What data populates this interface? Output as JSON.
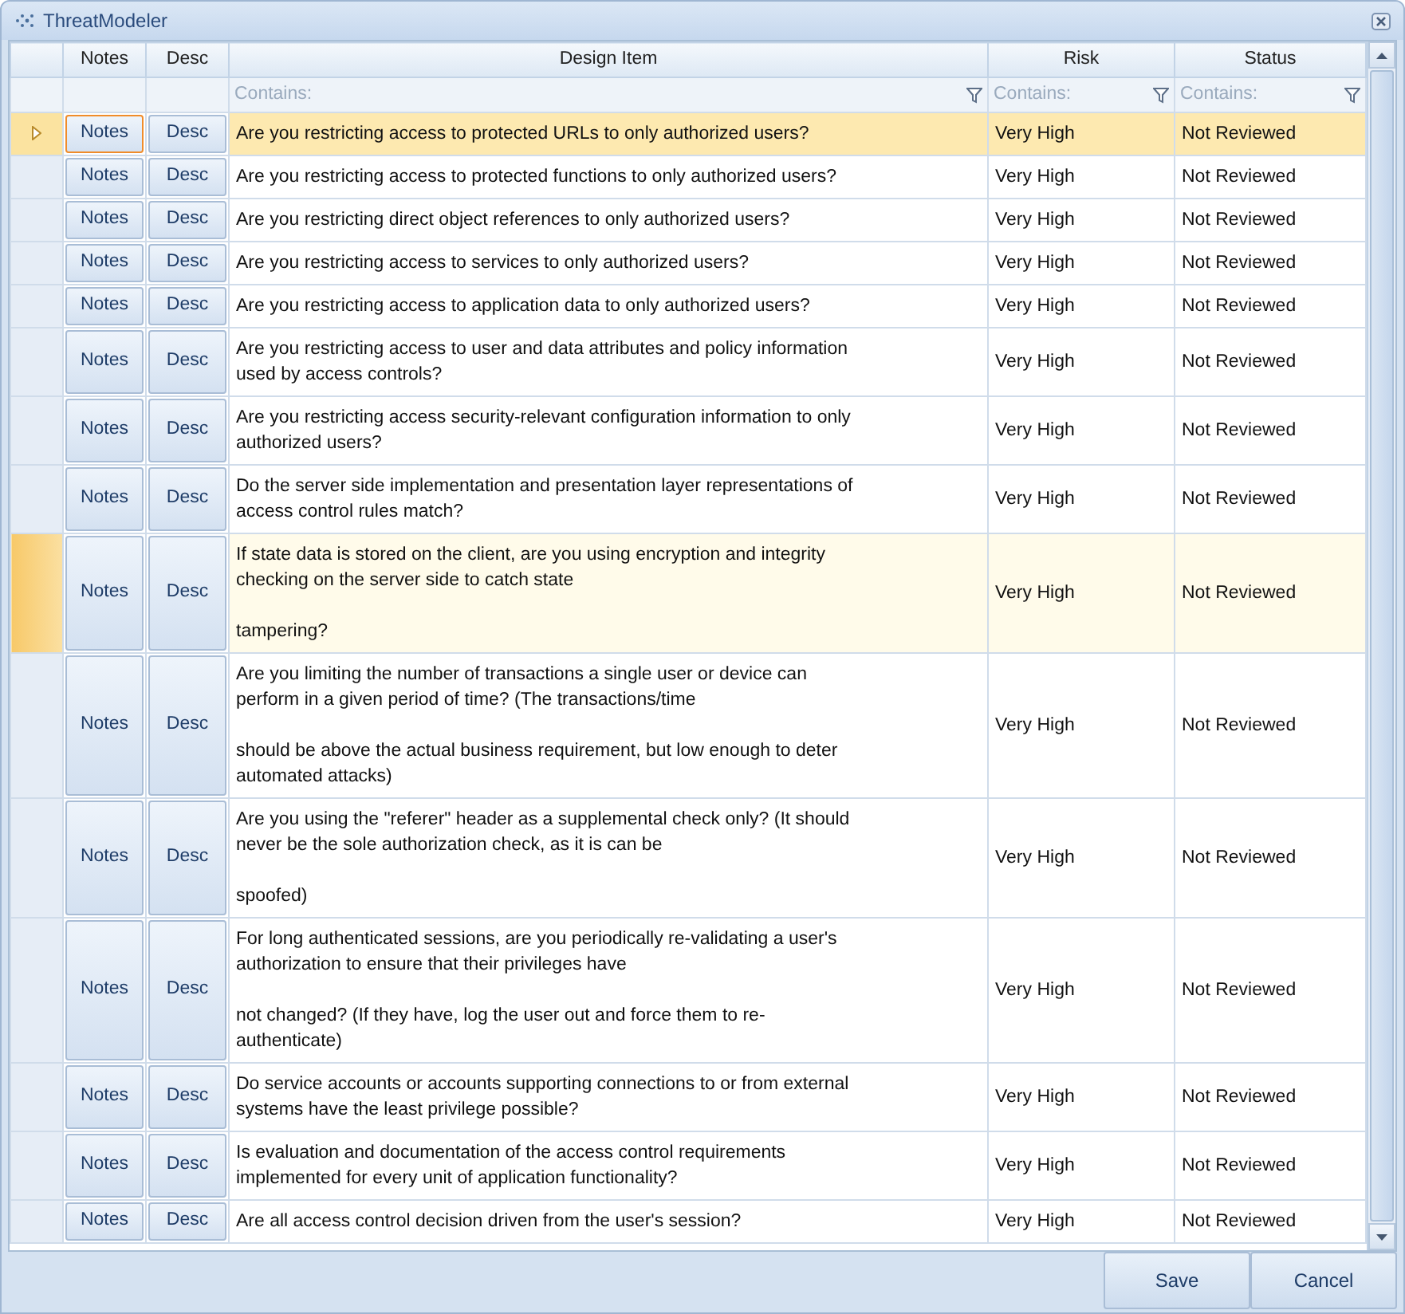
{
  "window": {
    "title": "ThreatModeler"
  },
  "columns": [
    "Notes",
    "Desc",
    "Design Item",
    "Risk",
    "Status"
  ],
  "filters": [
    {
      "placeholder": "Contains:"
    },
    {
      "placeholder": "Contains:"
    },
    {
      "placeholder": "Contains:"
    }
  ],
  "rows": [
    {
      "notes": "Notes",
      "desc": "Desc",
      "design_item": "Are you restricting access to protected URLs to only authorized users?",
      "risk": "Very High",
      "status": "Not Reviewed",
      "selected": true,
      "hovered": false
    },
    {
      "notes": "Notes",
      "desc": "Desc",
      "design_item": "Are you restricting access to protected functions to only authorized users?",
      "risk": "Very High",
      "status": "Not Reviewed",
      "selected": false,
      "hovered": false
    },
    {
      "notes": "Notes",
      "desc": "Desc",
      "design_item": "Are you restricting direct object references to only authorized users?",
      "risk": "Very High",
      "status": "Not Reviewed",
      "selected": false,
      "hovered": false
    },
    {
      "notes": "Notes",
      "desc": "Desc",
      "design_item": "Are you restricting access to services to only authorized users?",
      "risk": "Very High",
      "status": "Not Reviewed",
      "selected": false,
      "hovered": false
    },
    {
      "notes": "Notes",
      "desc": "Desc",
      "design_item": "Are you restricting access to application data to only authorized users?",
      "risk": "Very High",
      "status": "Not Reviewed",
      "selected": false,
      "hovered": false
    },
    {
      "notes": "Notes",
      "desc": "Desc",
      "design_item": "Are you restricting access to user and data attributes and policy information\nused by access controls?",
      "risk": "Very High",
      "status": "Not Reviewed",
      "selected": false,
      "hovered": false
    },
    {
      "notes": "Notes",
      "desc": "Desc",
      "design_item": "Are you restricting access security-relevant configuration information to only\nauthorized users?",
      "risk": "Very High",
      "status": "Not Reviewed",
      "selected": false,
      "hovered": false
    },
    {
      "notes": "Notes",
      "desc": "Desc",
      "design_item": "Do the server side implementation and presentation layer representations of\naccess control rules match?",
      "risk": "Very High",
      "status": "Not Reviewed",
      "selected": false,
      "hovered": false
    },
    {
      "notes": "Notes",
      "desc": "Desc",
      "design_item": "If state data is stored on the client, are you using encryption and integrity\nchecking on the server side to catch state\n\ntampering?",
      "risk": "Very High",
      "status": "Not Reviewed",
      "selected": false,
      "hovered": true
    },
    {
      "notes": "Notes",
      "desc": "Desc",
      "design_item": "Are you limiting the number of transactions a single user or device can\nperform in a given period of time? (The transactions/time\n\nshould be above the actual business requirement, but low enough to deter\nautomated attacks)",
      "risk": "Very High",
      "status": "Not Reviewed",
      "selected": false,
      "hovered": false
    },
    {
      "notes": "Notes",
      "desc": "Desc",
      "design_item": "Are you using the \"referer\" header as a supplemental check only? (It should\nnever be the sole authorization check, as it is can be\n\nspoofed)",
      "risk": "Very High",
      "status": "Not Reviewed",
      "selected": false,
      "hovered": false
    },
    {
      "notes": "Notes",
      "desc": "Desc",
      "design_item": "For long authenticated sessions, are you periodically re-validating a user's\nauthorization to ensure that their privileges have\n\nnot changed? (If they have, log the user out and force them to re-\nauthenticate)",
      "risk": "Very High",
      "status": "Not Reviewed",
      "selected": false,
      "hovered": false
    },
    {
      "notes": "Notes",
      "desc": "Desc",
      "design_item": "Do service accounts or accounts supporting connections to or from external\nsystems have the least privilege possible?",
      "risk": "Very High",
      "status": "Not Reviewed",
      "selected": false,
      "hovered": false
    },
    {
      "notes": "Notes",
      "desc": "Desc",
      "design_item": "Is evaluation and documentation of the access control requirements\nimplemented for every unit of application functionality?",
      "risk": "Very High",
      "status": "Not Reviewed",
      "selected": false,
      "hovered": false
    },
    {
      "notes": "Notes",
      "desc": "Desc",
      "design_item": "Are all access control decision driven from the user's session?",
      "risk": "Very High",
      "status": "Not Reviewed",
      "selected": false,
      "hovered": false
    }
  ],
  "buttons": [
    "Save",
    "Cancel"
  ]
}
